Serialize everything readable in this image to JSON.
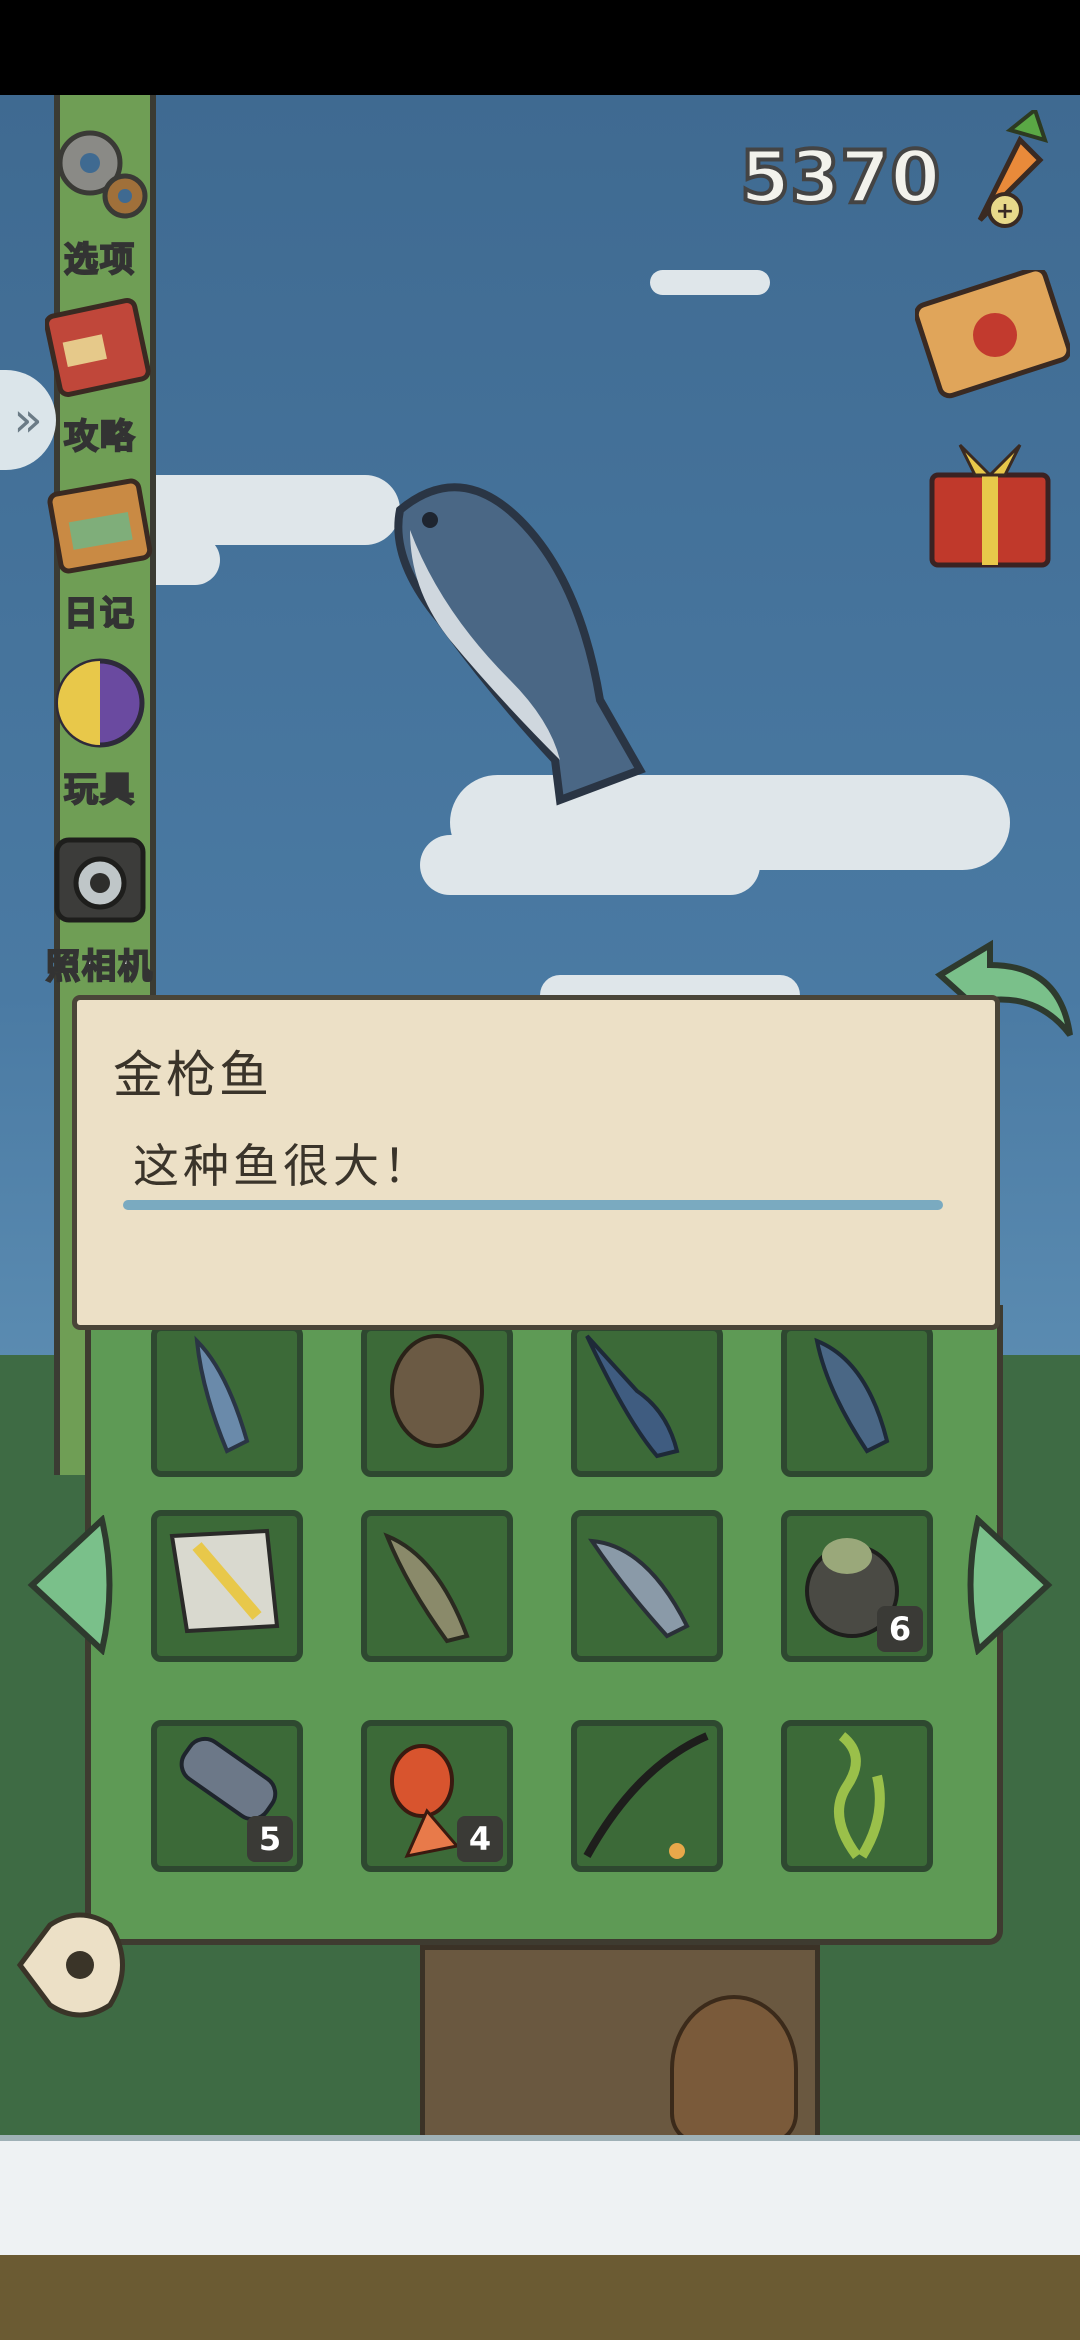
{
  "currency": {
    "amount": "5370"
  },
  "sidebar": {
    "items": [
      {
        "label": "选项",
        "icon": "gear-icon"
      },
      {
        "label": "攻略",
        "icon": "guide-book-icon"
      },
      {
        "label": "日记",
        "icon": "diary-icon"
      },
      {
        "label": "玩具",
        "icon": "toy-ball-icon"
      },
      {
        "label": "照相机",
        "icon": "camera-icon"
      }
    ],
    "expand_glyph": "»"
  },
  "popup": {
    "title": "金枪鱼",
    "description": "这种鱼很大！"
  },
  "inventory": {
    "rows": [
      [
        {
          "item": "sardine",
          "count": ""
        },
        {
          "item": "flatfish",
          "count": ""
        },
        {
          "item": "swordfish",
          "count": ""
        },
        {
          "item": "tuna",
          "count": ""
        }
      ],
      [
        {
          "item": "triggerfish",
          "count": ""
        },
        {
          "item": "catfish",
          "count": ""
        },
        {
          "item": "salmon",
          "count": ""
        },
        {
          "item": "trash-bag",
          "count": "6"
        }
      ],
      [
        {
          "item": "plastic-bottle",
          "count": "5"
        },
        {
          "item": "goldfish",
          "count": "4"
        },
        {
          "item": "fishing-rod",
          "count": ""
        },
        {
          "item": "seaweed",
          "count": ""
        }
      ]
    ]
  },
  "colors": {
    "sky": "#4a7aa3",
    "panel": "#5e9a55",
    "slot": "#3c6a38",
    "popup_bg": "#ece0c6",
    "underline": "#7aaac0"
  }
}
